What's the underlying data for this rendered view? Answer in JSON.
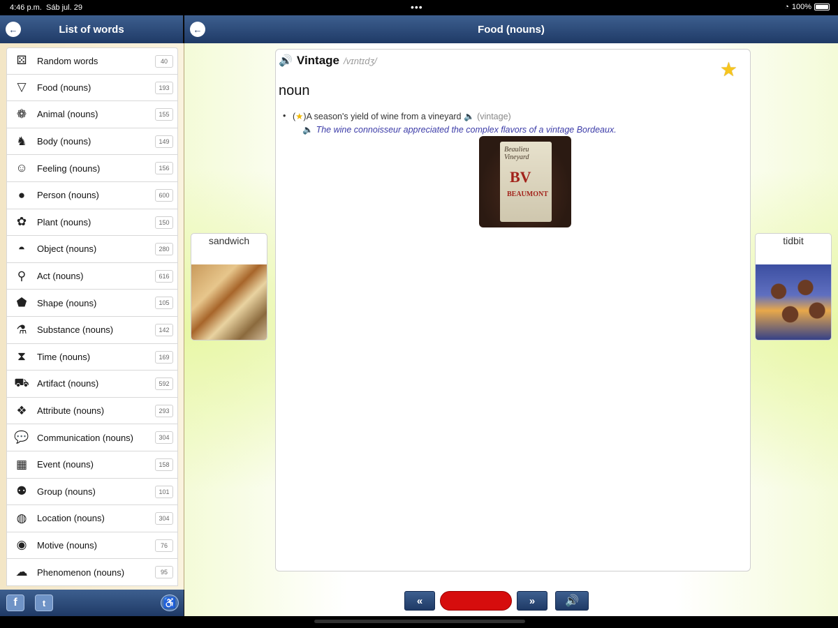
{
  "status_bar": {
    "time": "4:46 p.m.",
    "date": "Sáb jul. 29",
    "dots": "•••",
    "battery": "100%",
    "wifi_icon": "wifi-icon"
  },
  "sidebar": {
    "title": "List of words",
    "items": [
      {
        "label": "Random words",
        "count": "40",
        "icon": "random-icon"
      },
      {
        "label": "Food (nouns)",
        "count": "193",
        "icon": "pizza-icon"
      },
      {
        "label": "Animal (nouns)",
        "count": "155",
        "icon": "paw-icon"
      },
      {
        "label": "Body (nouns)",
        "count": "149",
        "icon": "body-icon"
      },
      {
        "label": "Feeling (nouns)",
        "count": "156",
        "icon": "masks-icon"
      },
      {
        "label": "Person (nouns)",
        "count": "600",
        "icon": "person-icon"
      },
      {
        "label": "Plant (nouns)",
        "count": "150",
        "icon": "plant-icon"
      },
      {
        "label": "Object (nouns)",
        "count": "280",
        "icon": "hat-icon"
      },
      {
        "label": "Act (nouns)",
        "count": "616",
        "icon": "bicycle-icon"
      },
      {
        "label": "Shape (nouns)",
        "count": "105",
        "icon": "pentagon-icon"
      },
      {
        "label": "Substance (nouns)",
        "count": "142",
        "icon": "flask-icon"
      },
      {
        "label": "Time (nouns)",
        "count": "169",
        "icon": "hourglass-icon"
      },
      {
        "label": "Artifact (nouns)",
        "count": "592",
        "icon": "car-icon"
      },
      {
        "label": "Attribute (nouns)",
        "count": "293",
        "icon": "attribute-icon"
      },
      {
        "label": "Communication (nouns)",
        "count": "304",
        "icon": "speech-bubble-icon"
      },
      {
        "label": "Event (nouns)",
        "count": "158",
        "icon": "calendar-icon"
      },
      {
        "label": "Group (nouns)",
        "count": "101",
        "icon": "group-icon"
      },
      {
        "label": "Location (nouns)",
        "count": "304",
        "icon": "globe-icon"
      },
      {
        "label": "Motive (nouns)",
        "count": "76",
        "icon": "motive-icon"
      },
      {
        "label": "Phenomenon (nouns)",
        "count": "95",
        "icon": "cloud-icon"
      }
    ]
  },
  "main": {
    "title": "Food (nouns)",
    "word": "Vintage",
    "pronunciation": "/vɪntɪdʒ/",
    "part_of_speech": "noun",
    "sense": {
      "paren_open": "(",
      "paren_close": ")",
      "definition": "A season's yield of wine from a vineyard",
      "link_text": "(vintage)",
      "example": "The wine connoisseur appreciated the complex flavors of a vintage Bordeaux."
    },
    "image_label": {
      "line1": "Beaulieu Vineyard",
      "brand": "BV",
      "line2": "BEAUMONT"
    },
    "prev_word": "sandwich",
    "next_word": "tidbit"
  },
  "controls": {
    "prev": "«",
    "next": "»"
  },
  "social": {
    "facebook": "f",
    "twitter": "t"
  },
  "colors": {
    "navbar": "#1f3a66",
    "accent_red": "#d60d0d",
    "star": "#f7c51e"
  }
}
